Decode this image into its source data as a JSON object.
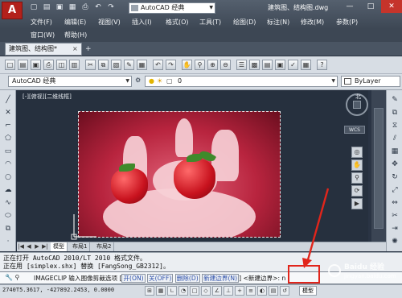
{
  "app": {
    "logo_letter": "A",
    "workspace": "AutoCAD 经典",
    "doc_title": "建筑图、结构图.dwg",
    "window_controls": [
      "—",
      "□",
      "✕"
    ]
  },
  "menus": {
    "row1": [
      "文件(F)",
      "编辑(E)",
      "视图(V)",
      "插入(I)",
      "格式(O)",
      "工具(T)",
      "绘图(D)",
      "标注(N)",
      "修改(M)",
      "参数(P)"
    ],
    "row2": [
      "窗口(W)",
      "帮助(H)"
    ]
  },
  "doc_tab": {
    "label": "建筑图、结构图*",
    "close": "×"
  },
  "toolbar2": {
    "workspace_select": "AutoCAD 经典",
    "layer_select": "0",
    "linetype_select": "ByLayer"
  },
  "viewport": {
    "label": "[-][俯视][二维线框]",
    "compass_n": "北",
    "wcs": "WCS"
  },
  "layout_tabs": [
    "模型",
    "布局1",
    "布局2"
  ],
  "command": {
    "history_1": "正在打开 AutoCAD 2010/LT 2010 格式文件。",
    "history_2": "正在用 [simplex.shx] 替换 [FangSong_GB2312]。",
    "prompt_prefix": "IMAGECLIP 输入图像剪裁选项 [",
    "opt_on": "开(ON)",
    "opt_off": "关(OFF)",
    "opt_delete": "删除(D)",
    "opt_new": "新建边界(N)",
    "prompt_mid": "] <新建边界>:",
    "input_value": "n"
  },
  "status": {
    "coords": "2740T5.3617, -427892.2453, 0.0000",
    "model_label": "模型"
  },
  "watermark": {
    "title": "Baidu 经验",
    "sub": "jingyan.baidu.com"
  },
  "colors": {
    "callout_red": "#e1251b",
    "canvas_bg": "#26303e",
    "title_bg": "#3d4754"
  }
}
